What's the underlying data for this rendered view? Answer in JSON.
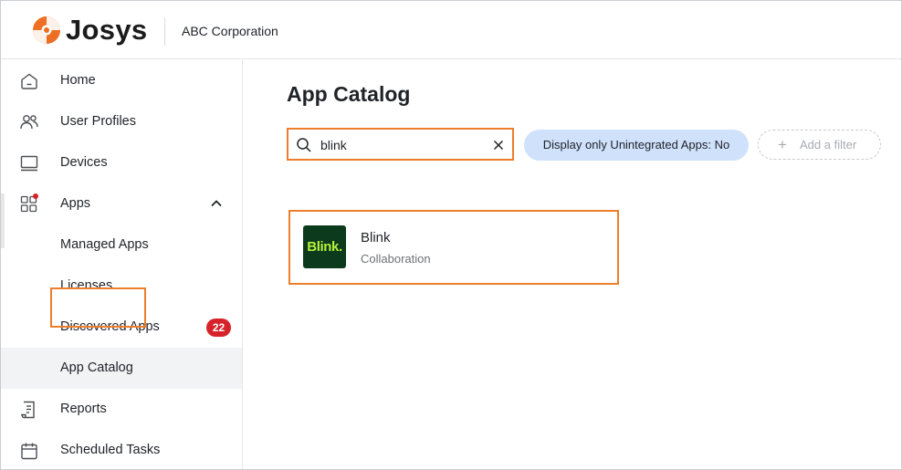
{
  "header": {
    "brand_name": "Josys",
    "organization": "ABC Corporation",
    "brand_color": "#ec6f23"
  },
  "sidebar": {
    "items": [
      {
        "label": "Home",
        "icon": "home-icon"
      },
      {
        "label": "User Profiles",
        "icon": "users-icon"
      },
      {
        "label": "Devices",
        "icon": "monitor-icon"
      },
      {
        "label": "Apps",
        "icon": "apps-grid-icon",
        "expanded": true,
        "notification_dot": true
      },
      {
        "label": "Managed Apps"
      },
      {
        "label": "Licenses"
      },
      {
        "label": "Discovered Apps",
        "badge": "22"
      },
      {
        "label": "App Catalog",
        "active": true
      },
      {
        "label": "Reports",
        "icon": "report-icon"
      },
      {
        "label": "Scheduled Tasks",
        "icon": "calendar-icon"
      }
    ]
  },
  "main": {
    "title": "App Catalog",
    "search": {
      "value": "blink",
      "placeholder": ""
    },
    "filter_chip": "Display only Unintegrated Apps: No",
    "add_filter_label": "Add a filter",
    "results": [
      {
        "logo_text": "Blink.",
        "name": "Blink",
        "category": "Collaboration"
      }
    ]
  },
  "colors": {
    "highlight": "#ec7e2c",
    "chip_bg": "#cfe1fb",
    "badge_bg": "#d6232b",
    "active_bg": "#f2f3f5"
  }
}
